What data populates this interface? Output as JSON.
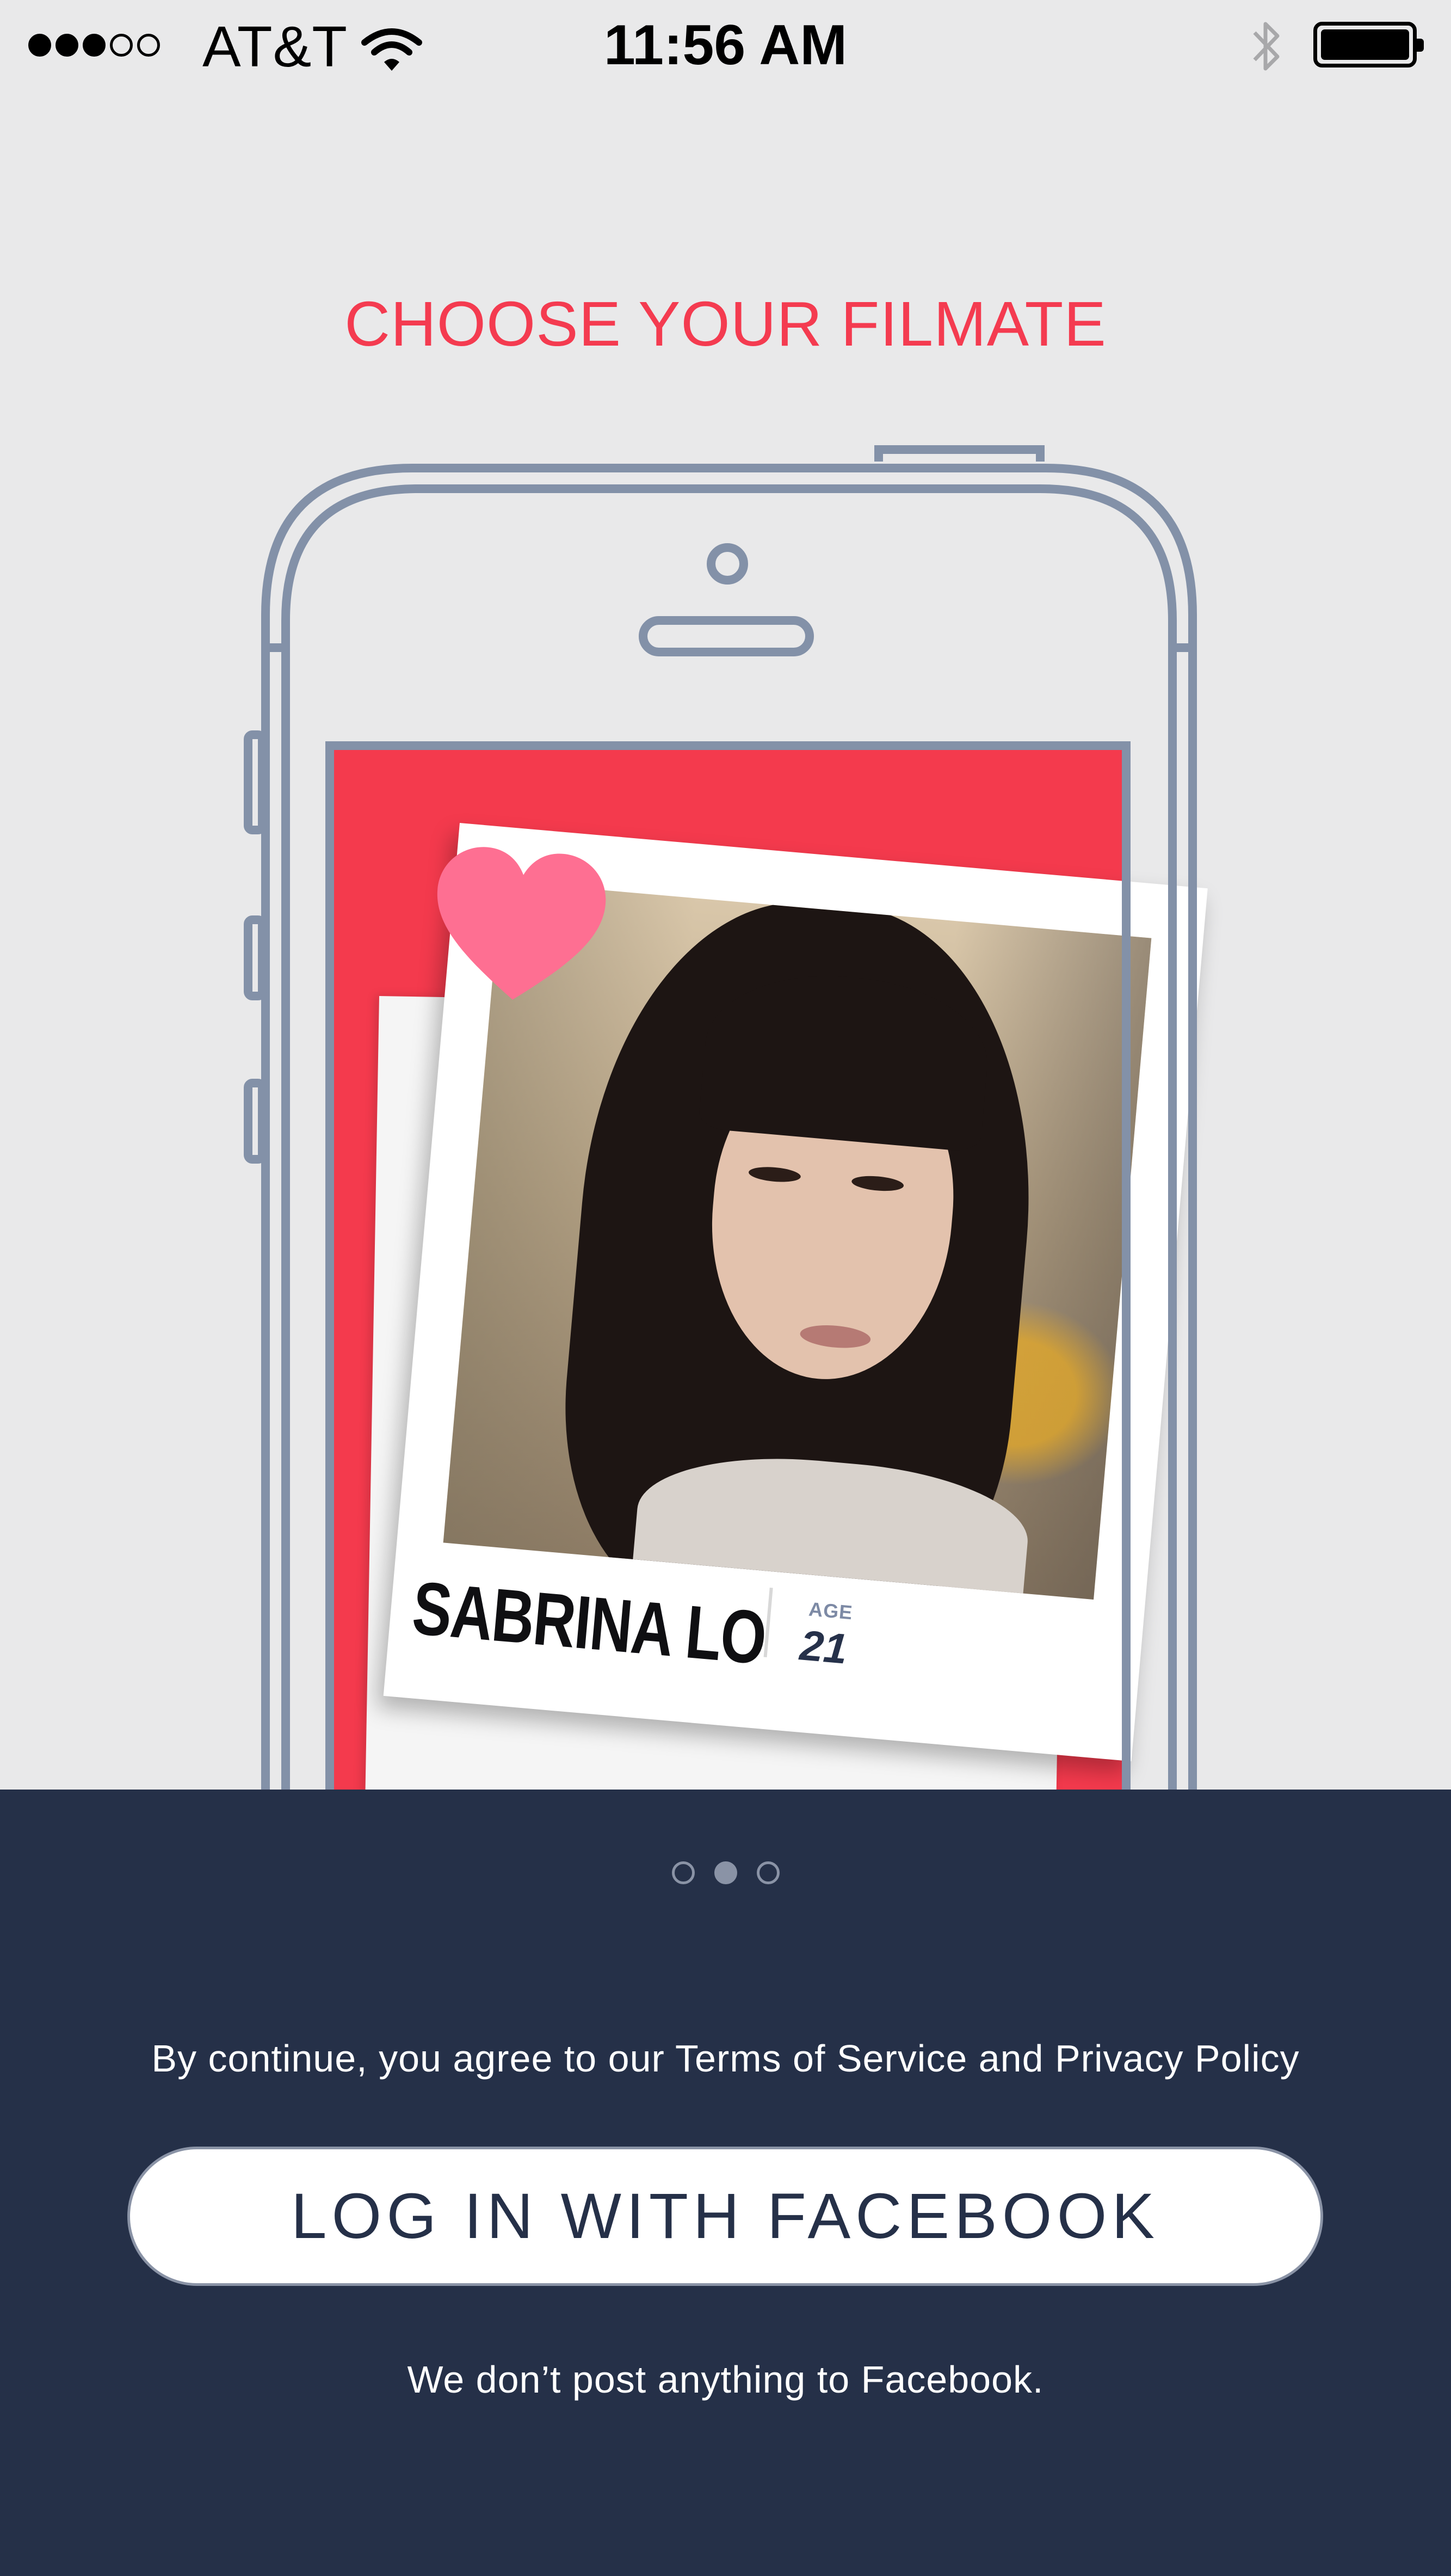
{
  "status_bar": {
    "carrier": "AT&T",
    "time": "11:56 AM",
    "signal_strength": 3,
    "signal_total": 5,
    "battery_level": 1.0
  },
  "heading": "CHOOSE YOUR FILMATE",
  "profile_card": {
    "name": "SABRINA LO",
    "age_label": "AGE",
    "age": "21"
  },
  "pager": {
    "total": 3,
    "active_index": 1
  },
  "footer": {
    "terms_text": "By continue, you agree to our Terms of Service and Privacy Policy",
    "facebook_button_label": "LOG IN WITH FACEBOOK",
    "disclaimer": "We don’t post anything to Facebook."
  },
  "colors": {
    "accent": "#f43b50",
    "panel": "#253048",
    "outline": "#8391a8",
    "heart": "#fe6f92"
  }
}
